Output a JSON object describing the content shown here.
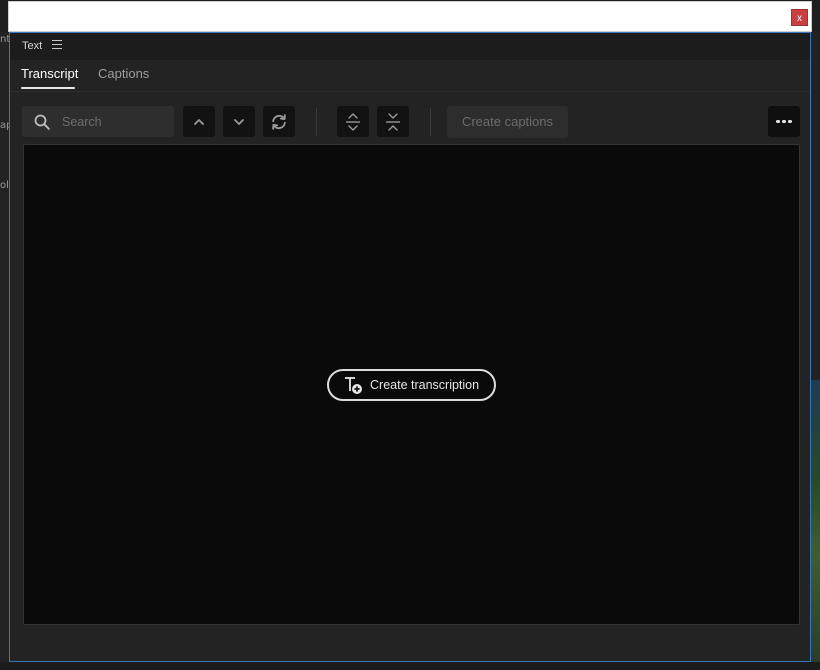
{
  "background": {
    "left_snippets": [
      "nt",
      "ap",
      "oli"
    ]
  },
  "titlebar": {
    "close_label": "x"
  },
  "panel": {
    "title": "Text"
  },
  "tabs": [
    {
      "label": "Transcript",
      "active": true
    },
    {
      "label": "Captions",
      "active": false
    }
  ],
  "toolbar": {
    "search_placeholder": "Search",
    "search_value": "",
    "create_captions_label": "Create captions",
    "icons": [
      "chevron-up-icon",
      "chevron-down-icon",
      "sync-icon",
      "expand-icon",
      "collapse-icon",
      "more-icon"
    ]
  },
  "content": {
    "create_transcription_label": "Create transcription"
  },
  "colors": {
    "panel_bg": "#232323",
    "content_bg": "#0a0a0a",
    "focus_border": "#3b76b8",
    "close_red": "#c8403f"
  }
}
